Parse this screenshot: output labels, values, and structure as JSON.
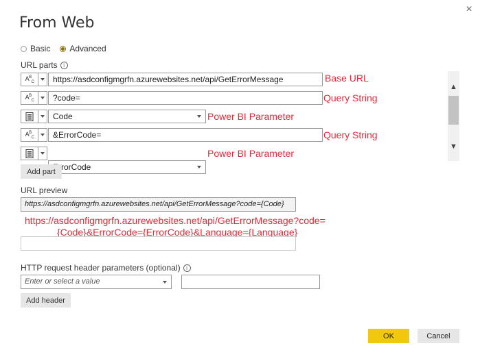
{
  "dialog": {
    "title": "From Web",
    "close_icon": "×"
  },
  "mode": {
    "options": [
      {
        "label": "Basic",
        "selected": false
      },
      {
        "label": "Advanced",
        "selected": true
      }
    ],
    "accent": "#8c6d00"
  },
  "url_parts": {
    "label": "URL parts",
    "info_icon": "i",
    "rows": [
      {
        "type": "text-abc",
        "value": "https://asdconfigmgrfn.azurewebsites.net/api/GetErrorMessage",
        "annotation": "Base URL"
      },
      {
        "type": "text-abc",
        "value": "?code=",
        "annotation": "Query String"
      },
      {
        "type": "parameter",
        "value": "Code",
        "annotation": "Power BI Parameter"
      },
      {
        "type": "text-abc",
        "value": "&ErrorCode=",
        "annotation": "Query String"
      },
      {
        "type": "parameter",
        "value": "ErrorCode",
        "annotation": "Power BI Parameter"
      }
    ],
    "add_part_label": "Add part"
  },
  "url_preview": {
    "label": "URL preview",
    "value": "https://asdconfigmgrfn.azurewebsites.net/api/GetErrorMessage?code={Code}",
    "annotation_line1": "https://asdconfigmgrfn.azurewebsites.net/api/GetErrorMessage?code=",
    "annotation_line2": "{Code}&ErrorCode={ErrorCode}&Language={Language}"
  },
  "headers": {
    "label": "HTTP request header parameters (optional)",
    "info_icon": "i",
    "placeholder": "Enter or select a value",
    "add_header_label": "Add header"
  },
  "footer": {
    "ok_label": "OK",
    "cancel_label": "Cancel",
    "ok_color": "#f2c80f"
  },
  "annotation_color": "#e8283a"
}
